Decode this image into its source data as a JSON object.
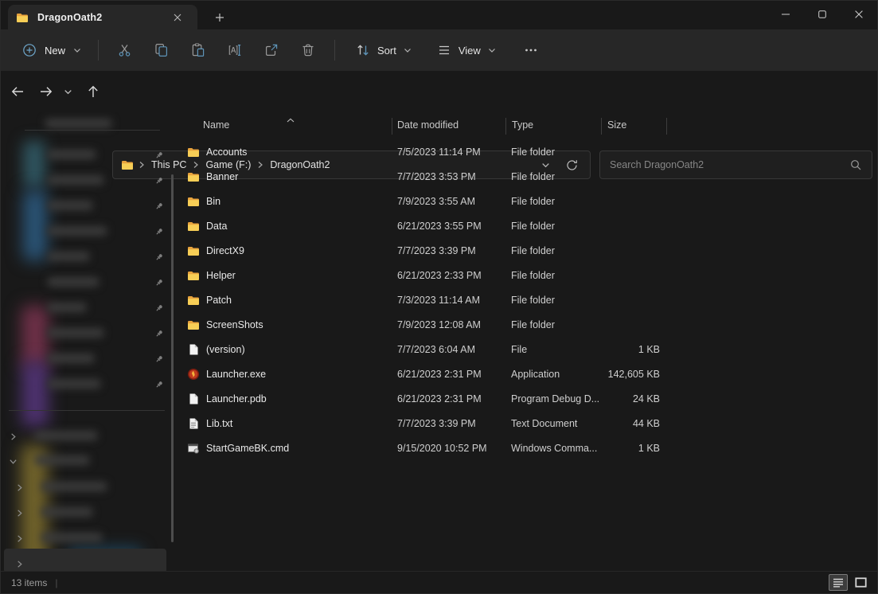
{
  "window": {
    "tab_title": "DragonOath2"
  },
  "toolbar": {
    "new_label": "New",
    "sort_label": "Sort",
    "view_label": "View"
  },
  "address_bar": {
    "breadcrumbs": [
      "This PC",
      "Game (F:)",
      "DragonOath2"
    ]
  },
  "search": {
    "placeholder": "Search DragonOath2"
  },
  "list": {
    "columns": [
      "Name",
      "Date modified",
      "Type",
      "Size"
    ],
    "files": [
      {
        "name": "Accounts",
        "date": "7/5/2023 11:14 PM",
        "type": "File folder",
        "size": "",
        "icon": "folder"
      },
      {
        "name": "Banner",
        "date": "7/7/2023 3:53 PM",
        "type": "File folder",
        "size": "",
        "icon": "folder"
      },
      {
        "name": "Bin",
        "date": "7/9/2023 3:55 AM",
        "type": "File folder",
        "size": "",
        "icon": "folder"
      },
      {
        "name": "Data",
        "date": "6/21/2023 3:55 PM",
        "type": "File folder",
        "size": "",
        "icon": "folder"
      },
      {
        "name": "DirectX9",
        "date": "7/7/2023 3:39 PM",
        "type": "File folder",
        "size": "",
        "icon": "folder"
      },
      {
        "name": "Helper",
        "date": "6/21/2023 2:33 PM",
        "type": "File folder",
        "size": "",
        "icon": "folder"
      },
      {
        "name": "Patch",
        "date": "7/3/2023 11:14 AM",
        "type": "File folder",
        "size": "",
        "icon": "folder"
      },
      {
        "name": "ScreenShots",
        "date": "7/9/2023 12:08 AM",
        "type": "File folder",
        "size": "",
        "icon": "folder"
      },
      {
        "name": "(version)",
        "date": "7/7/2023 6:04 AM",
        "type": "File",
        "size": "1 KB",
        "icon": "file"
      },
      {
        "name": "Launcher.exe",
        "date": "6/21/2023 2:31 PM",
        "type": "Application",
        "size": "142,605 KB",
        "icon": "exe"
      },
      {
        "name": "Launcher.pdb",
        "date": "6/21/2023 2:31 PM",
        "type": "Program Debug D...",
        "size": "24 KB",
        "icon": "file"
      },
      {
        "name": "Lib.txt",
        "date": "7/7/2023 3:39 PM",
        "type": "Text Document",
        "size": "44 KB",
        "icon": "txt"
      },
      {
        "name": "StartGameBK.cmd",
        "date": "9/15/2020 10:52 PM",
        "type": "Windows Comma...",
        "size": "1 KB",
        "icon": "cmd"
      }
    ]
  },
  "status_bar": {
    "items_text": "13 items"
  },
  "colors": {
    "accent_blue": "#5e94b8",
    "folder_yellow_front": "#f7ce56",
    "folder_yellow_back": "#e8a33d",
    "background": "#191919",
    "command_bar": "#272727"
  }
}
